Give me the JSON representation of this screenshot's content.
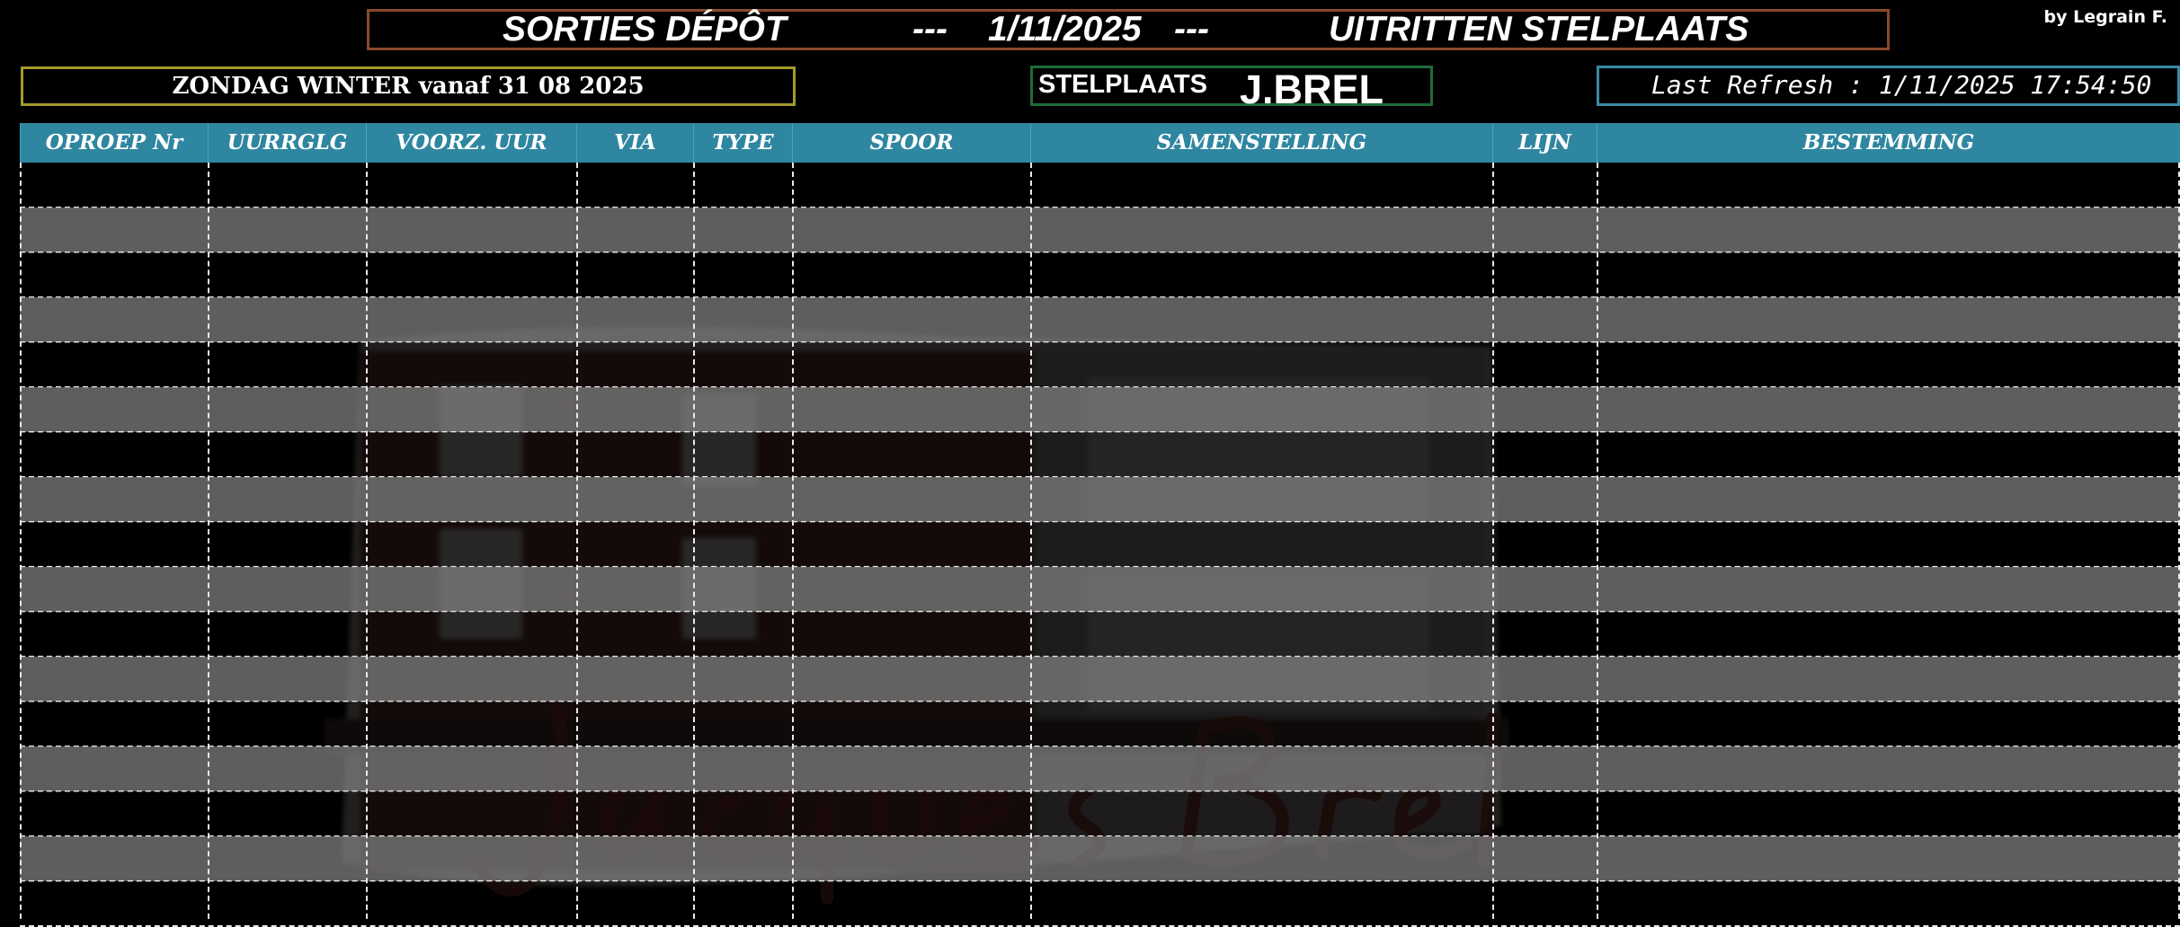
{
  "header": {
    "title_left": "SORTIES DÉPÔT",
    "sep1": "---",
    "date": "1/11/2025",
    "sep2": "---",
    "title_right": "UITRITTEN STELPLAATS",
    "credit": "by Legrain F."
  },
  "schedule": "ZONDAG WINTER vanaf  31 08 2025",
  "depot": {
    "label": "STELPLAATS",
    "value": "J.BREL"
  },
  "refresh": "Last Refresh : 1/11/2025 17:54:50",
  "table": {
    "columns": [
      "OPROEP Nr",
      "UURRGLG",
      "VOORZ. UUR",
      "VIA",
      "TYPE",
      "SPOOR",
      "SAMENSTELLING",
      "LIJN",
      "BESTEMMING"
    ],
    "row_count": 17,
    "rows": []
  },
  "colors": {
    "header_bg": "#2f86a0",
    "title_border": "#8a4a2a",
    "schedule_border": "#a39b2a",
    "depot_border": "#1e6b3a",
    "refresh_border": "#3a8aa6"
  },
  "watermark": {
    "caption": "Jacques Brel"
  }
}
